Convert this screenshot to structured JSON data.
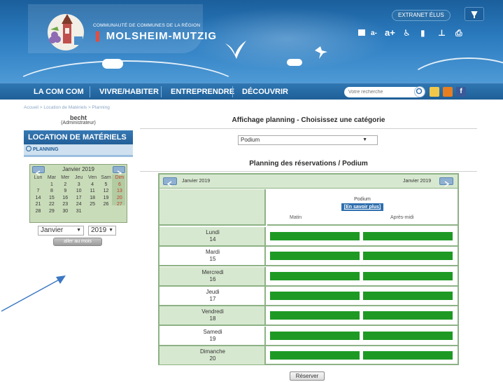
{
  "header": {
    "logo_small": "COMMUNAUTÉ DE COMMUNES DE LA RÉGION",
    "logo_big": "MOLSHEIM-MUTZIG",
    "extranet_label": "EXTRANET ÉLUS",
    "tools": [
      "a-",
      "a+"
    ]
  },
  "nav": {
    "items": [
      "LA COM COM",
      "VIVRE/HABITER",
      "ENTREPRENDRE",
      "DÉCOUVRIR"
    ],
    "search_placeholder": "Votre recherche"
  },
  "sidebar": {
    "breadcrumb": "Accueil > Location de Matériels > Planning",
    "user_name": "becht",
    "user_role": "(Administrateur)",
    "title": "LOCATION DE MATÉRIELS",
    "menu_item": "PLANNING",
    "calendar": {
      "title": "Janvier 2019",
      "prev": "<<",
      "next": ">>",
      "weekdays": [
        "Lun",
        "Mar",
        "Mer",
        "Jeu",
        "Ven",
        "Sam",
        "Dim"
      ],
      "weeks": [
        [
          "",
          "1",
          "2",
          "3",
          "4",
          "5",
          "6"
        ],
        [
          "7",
          "8",
          "9",
          "10",
          "11",
          "12",
          "13"
        ],
        [
          "14",
          "15",
          "16",
          "17",
          "18",
          "19",
          "20"
        ],
        [
          "21",
          "22",
          "23",
          "24",
          "25",
          "26",
          "27"
        ],
        [
          "28",
          "29",
          "30",
          "31",
          "",
          "",
          ""
        ]
      ]
    },
    "month_select": "Janvier",
    "year_select": "2019",
    "goto_label": "aller au mois"
  },
  "main": {
    "title": "Affichage planning - Choisissez une catégorie",
    "category": "Podium",
    "subtitle": "Planning des réservations / Podium",
    "grid": {
      "left_month": "Janvier 2019",
      "right_month": "Janvier 2019",
      "resource": "Podium",
      "more_link": "[En savoir plus]",
      "col_matin": "Matin",
      "col_apm": "Après-midi",
      "days": [
        {
          "name": "Lundi",
          "date": "14"
        },
        {
          "name": "Mardi",
          "date": "15"
        },
        {
          "name": "Mercredi",
          "date": "16"
        },
        {
          "name": "Jeudi",
          "date": "17"
        },
        {
          "name": "Vendredi",
          "date": "18"
        },
        {
          "name": "Samedi",
          "date": "19"
        },
        {
          "name": "Dimanche",
          "date": "20"
        }
      ],
      "available_color": "#1e9a24"
    },
    "reserve_label": "Réserver"
  }
}
